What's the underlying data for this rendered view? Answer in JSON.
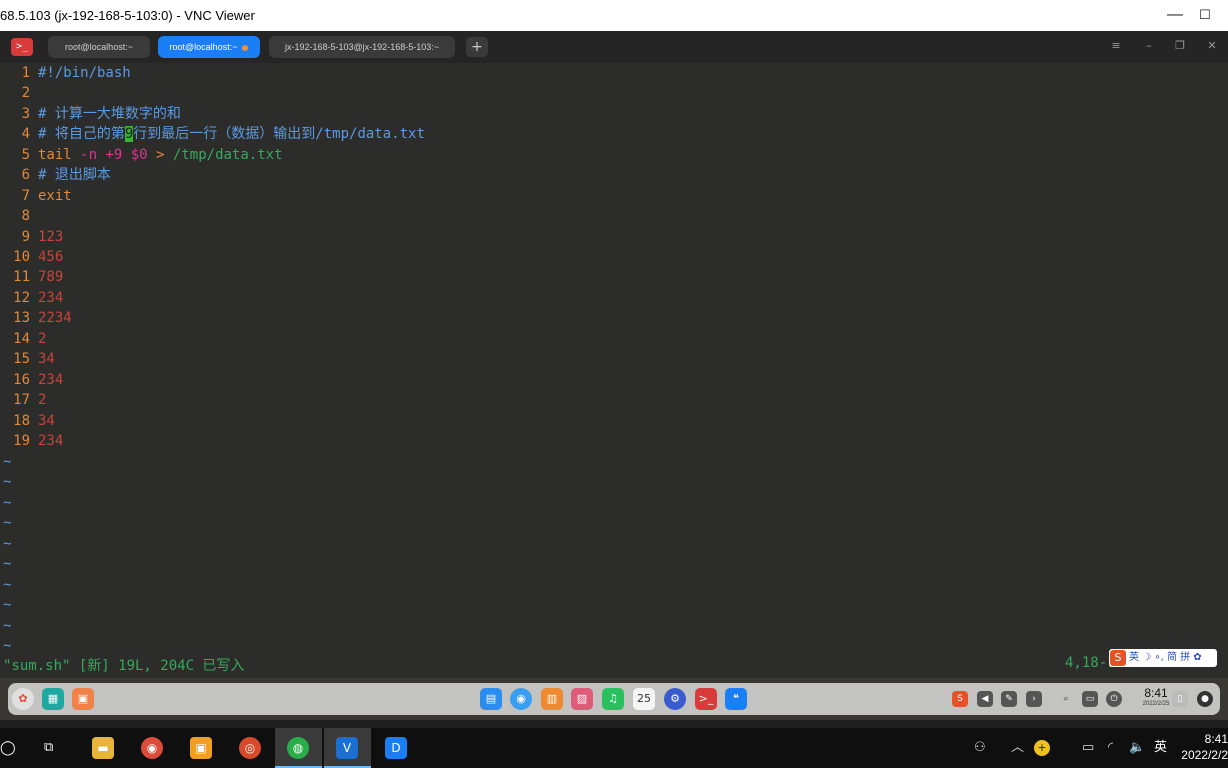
{
  "vnc": {
    "title": "68.5.103 (jx-192-168-5-103:0) - VNC Viewer",
    "minimize": "—",
    "maximize": "☐"
  },
  "terminal": {
    "app_icon": ">_",
    "tabs": [
      {
        "label": "root@localhost:~"
      },
      {
        "label": "root@localhost:~"
      },
      {
        "label": "jx-192-168-5-103@jx-192-168-5-103:~"
      }
    ],
    "add_tab": "+",
    "menu": "≡",
    "min": "–",
    "max": "❐",
    "close": "✕"
  },
  "editor": {
    "line_numbers": [
      "1",
      "2",
      "3",
      "4",
      "5",
      "6",
      "7",
      "8",
      "9",
      "10",
      "11",
      "12",
      "13",
      "14",
      "15",
      "16",
      "17",
      "18",
      "19"
    ],
    "shebang": "#!/bin/bash",
    "comment1": "# 计算一大堆数字的和",
    "comment2_pre": "# 将自己的第",
    "comment2_cursor": "9",
    "comment2_post": "行到最后一行（数据）输出到/tmp/data.txt",
    "tail_cmd": "tail",
    "tail_flag": "-n +9",
    "tail_var": "$0",
    "tail_redir": ">",
    "tail_path": "/tmp/data.txt",
    "comment3": "# 退出脚本",
    "exit_kw": "exit",
    "numbers": [
      "123",
      "456",
      "789",
      "234",
      "2234",
      "2",
      "34",
      "234",
      "2",
      "34",
      "234"
    ],
    "tilde": "~",
    "status_left": "\"sum.sh\" [新] 19L, 204C 已写入",
    "status_right": "4,18-13"
  },
  "ime": {
    "logo": "S",
    "text": "英 ☽ ∘, 简 拼 ✿"
  },
  "dock": {
    "time": "8:41",
    "date": "2022/2/25",
    "calendar_day": "25"
  },
  "taskbar": {
    "time": "8:41",
    "date": "2022/2/2",
    "lang": "英",
    "start": "◯",
    "taskview": "⧉",
    "up_arrow": "︿",
    "person": "⚇",
    "volume": "🔈"
  }
}
